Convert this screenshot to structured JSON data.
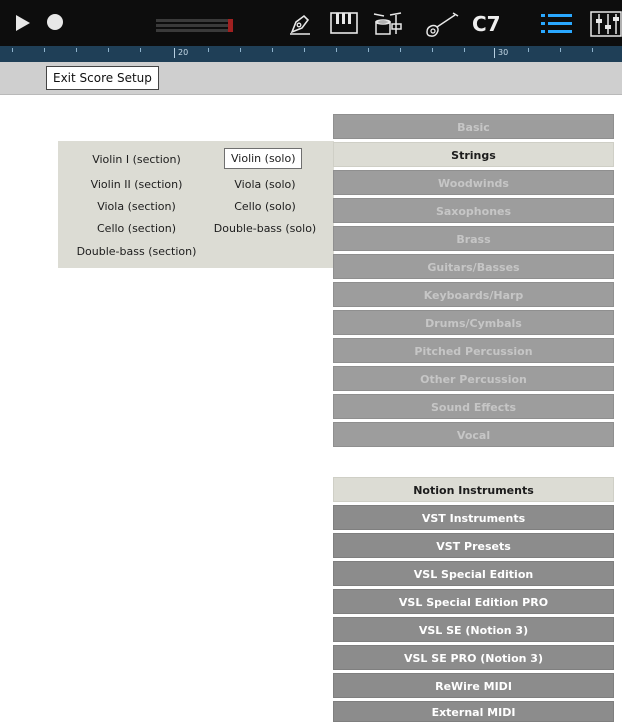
{
  "toolbar": {
    "key_label": "C7",
    "icons": [
      "play-icon",
      "record-icon",
      "level-meter",
      "pen-icon",
      "keyboard-icon",
      "drums-icon",
      "guitar-icon",
      "list-icon",
      "mixer-icon"
    ],
    "accent": "#2aa8ff"
  },
  "ruler": {
    "marks": [
      "20",
      "30"
    ]
  },
  "setup": {
    "exit_label": "Exit Score Setup"
  },
  "categories": [
    {
      "label": "Basic",
      "active": false
    },
    {
      "label": "Strings",
      "active": true
    },
    {
      "label": "Woodwinds",
      "active": false
    },
    {
      "label": "Saxophones",
      "active": false
    },
    {
      "label": "Brass",
      "active": false
    },
    {
      "label": "Guitars/Basses",
      "active": false
    },
    {
      "label": "Keyboards/Harp",
      "active": false
    },
    {
      "label": "Drums/Cymbals",
      "active": false
    },
    {
      "label": "Pitched Percussion",
      "active": false
    },
    {
      "label": "Other Percussion",
      "active": false
    },
    {
      "label": "Sound Effects",
      "active": false
    },
    {
      "label": "Vocal",
      "active": false
    }
  ],
  "sources": [
    {
      "label": "Notion Instruments",
      "active": true
    },
    {
      "label": "VST Instruments",
      "active": false
    },
    {
      "label": "VST Presets",
      "active": false
    },
    {
      "label": "VSL Special Edition",
      "active": false
    },
    {
      "label": "VSL Special Edition PRO",
      "active": false
    },
    {
      "label": "VSL SE (Notion 3)",
      "active": false
    },
    {
      "label": "VSL SE PRO (Notion 3)",
      "active": false
    },
    {
      "label": "ReWire MIDI",
      "active": false
    },
    {
      "label": "External MIDI",
      "active": false
    }
  ],
  "instruments": {
    "left": [
      "Violin I (section)",
      "Violin II (section)",
      "Viola (section)",
      "Cello (section)",
      "Double-bass (section)"
    ],
    "right": [
      "Violin (solo)",
      "Viola (solo)",
      "Cello (solo)",
      "Double-bass (solo)"
    ],
    "selected": "Violin (solo)"
  }
}
